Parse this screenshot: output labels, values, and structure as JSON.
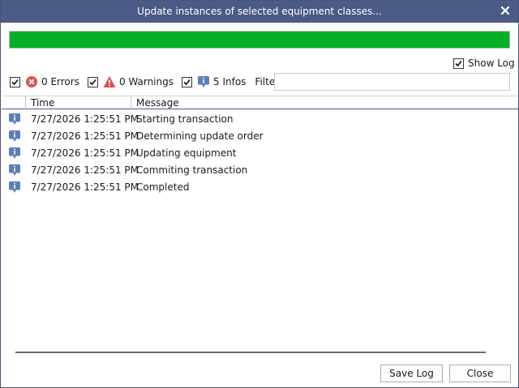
{
  "window": {
    "title": "Update instances of selected equipment classes..."
  },
  "progress": {
    "percent": 100,
    "color": "#06b025"
  },
  "show_log": {
    "label": "Show Log",
    "checked": true
  },
  "filters": {
    "errors": {
      "label": "0 Errors",
      "checked": true
    },
    "warnings": {
      "label": "0 Warnings",
      "checked": true
    },
    "infos": {
      "label": "5 Infos",
      "checked": true
    },
    "filter_label": "Filter:",
    "filter_value": ""
  },
  "log": {
    "columns": {
      "time": "Time",
      "message": "Message"
    },
    "rows": [
      {
        "icon": "info-icon",
        "time": "7/27/2026 1:25:51 PM",
        "message": "Starting transaction"
      },
      {
        "icon": "info-icon",
        "time": "7/27/2026 1:25:51 PM",
        "message": "Determining update order"
      },
      {
        "icon": "info-icon",
        "time": "7/27/2026 1:25:51 PM",
        "message": "Updating equipment"
      },
      {
        "icon": "info-icon",
        "time": "7/27/2026 1:25:51 PM",
        "message": "Commiting transaction"
      },
      {
        "icon": "info-icon",
        "time": "7/27/2026 1:25:51 PM",
        "message": "Completed"
      }
    ]
  },
  "buttons": {
    "save_log": "Save Log",
    "close": "Close"
  },
  "colors": {
    "titlebar": "#4c5a87",
    "accent": "#4c5a87",
    "info": "#5a7fb8",
    "error": "#d9534f",
    "warning": "#d9534f"
  }
}
